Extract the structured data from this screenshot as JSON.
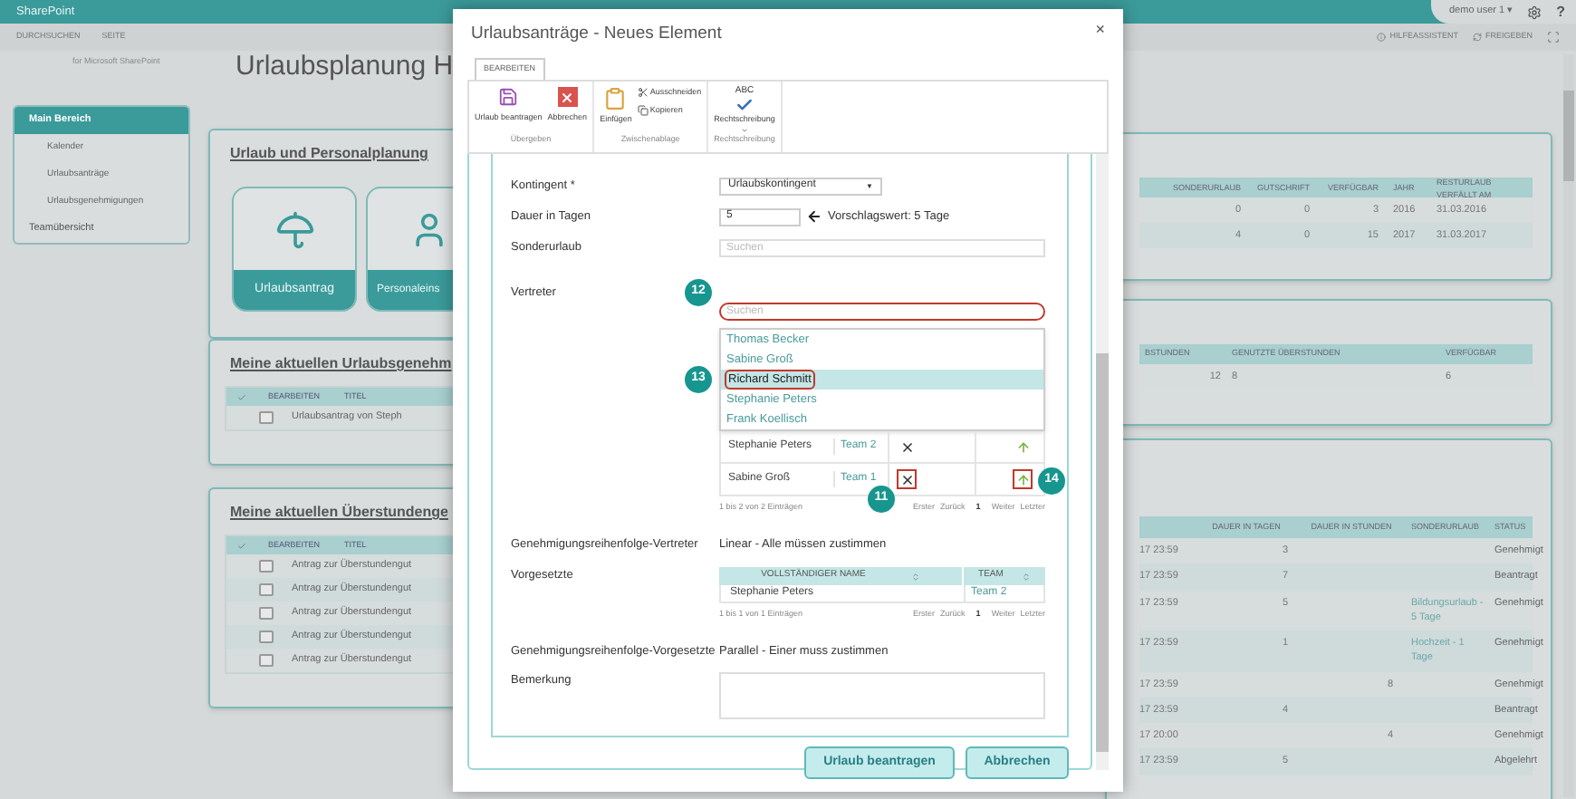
{
  "topbar": {
    "brand": "SharePoint",
    "user": "demo user 1 ▾",
    "help": "?"
  },
  "subbar": {
    "left": [
      "DURCHSUCHEN",
      "SEITE"
    ],
    "right": [
      {
        "label": "HILFEASSISTENT",
        "kind": "help"
      },
      {
        "label": "FREIGEBEN",
        "kind": "share"
      }
    ]
  },
  "logo_subtitle": "for Microsoft SharePoint",
  "page_title": "Urlaubsplanung H",
  "nav": [
    {
      "label": "Main Bereich",
      "selected": true,
      "children": [
        {
          "label": "Kalender"
        },
        {
          "label": "Urlaubsanträge"
        },
        {
          "label": "Urlaubsgenehmigungen"
        }
      ]
    },
    {
      "label": "Teamübersicht",
      "selected": false
    }
  ],
  "planning_panel": {
    "title": "Urlaub und Personalplanung",
    "tiles": [
      {
        "label": "Urlaubsantrag",
        "kind": "beach"
      },
      {
        "label": "Personaleins",
        "kind": "staff"
      }
    ]
  },
  "approvals_panel": {
    "title": "Meine aktuellen Urlaubsgenehm",
    "columns": [
      "BEARBEITEN",
      "TITEL"
    ],
    "rows": [
      "Urlaubsantrag von Steph"
    ]
  },
  "overtime_panel": {
    "title": "Meine aktuellen Überstundenge",
    "columns": [
      "BEARBEITEN",
      "TITEL"
    ],
    "rows": [
      "Antrag zur Überstundengut",
      "Antrag zur Überstundengut",
      "Antrag zur Überstundengut",
      "Antrag zur Überstundengut",
      "Antrag zur Überstundengut"
    ]
  },
  "quota_table": {
    "columns": [
      "SONDERURLAUB",
      "GUTSCHRIFT",
      "VERFÜGBAR",
      "JAHR",
      "RESTURLAUB VERFÄLLT AM"
    ],
    "rows": [
      [
        "0",
        "0",
        "3",
        "2016",
        "31.03.2016"
      ],
      [
        "4",
        "0",
        "15",
        "2017",
        "31.03.2017"
      ]
    ]
  },
  "overtime_table": {
    "columns": [
      "BSTUNDEN",
      "GENUTZTE ÜBERSTUNDEN",
      "VERFÜGBAR"
    ],
    "rows": [
      [
        "12",
        "8",
        "6"
      ]
    ]
  },
  "requests_table": {
    "columns": [
      "DAUER IN TAGEN",
      "DAUER IN STUNDEN",
      "SONDERURLAUB",
      "STATUS"
    ],
    "rows": [
      {
        "column_1": "17 23:59",
        "dauer_in_tagen": "3",
        "status": "Genehmigt"
      },
      {
        "column_1": "17 23:59",
        "dauer_in_tagen": "7",
        "status": "Beantragt"
      },
      {
        "column_1": "17 23:59",
        "dauer_in_tagen": "5",
        "sonderurlaub": "Bildungsurlaub - 5 Tage",
        "status": "Genehmigt"
      },
      {
        "column_1": "17 23:59",
        "dauer_in_tagen": "1",
        "sonderurlaub": "Hochzeit - 1 Tage",
        "status": "Genehmigt"
      },
      {
        "column_1": "17 23:59",
        "dauer_in_stunden": "8",
        "status": "Genehmigt"
      },
      {
        "column_1": "17 23:59",
        "dauer_in_tagen": "4",
        "status": "Beantragt"
      },
      {
        "column_1": "17 20:00",
        "dauer_in_stunden": "4",
        "status": "Genehmigt"
      },
      {
        "column_1": "17 23:59",
        "dauer_in_tagen": "5",
        "status": "Abgelehrt"
      }
    ]
  },
  "dialog": {
    "title": "Urlaubsanträge - Neues Element",
    "close": "×",
    "ribbon": {
      "tabs": [
        {
          "label": "BEARBEITEN",
          "selected": true
        }
      ],
      "groups": [
        {
          "label": "Übergeben",
          "buttons": [
            {
              "label": "Urlaub beantragen",
              "kind": "save"
            },
            {
              "label": "Abbrechen",
              "kind": "cancel"
            }
          ]
        },
        {
          "label": "Zwischenablage",
          "buttons": [
            {
              "label": "Einfügen",
              "kind": "paste"
            },
            {
              "label": "Ausschneiden",
              "kind": "cut"
            },
            {
              "label": "Kopieren",
              "kind": "copy"
            }
          ]
        },
        {
          "label": "Rechtschreibung",
          "buttons": [
            {
              "label": "Rechtschreibung",
              "kind": "spelling",
              "icon_text": "ABC"
            }
          ]
        }
      ]
    },
    "fields": [
      {
        "kind": "select",
        "label": "Kontingent *",
        "value": "Urlaubskontingent",
        "arrow": "▼"
      },
      {
        "kind": "number",
        "label": "Dauer in Tagen",
        "value": "5",
        "hint": "Vorschlagswert: 5 Tage"
      },
      {
        "kind": "search",
        "label": "Sonderurlaub",
        "placeholder": "Suchen"
      },
      {
        "kind": "people",
        "label": "Vertreter",
        "placeholder": "Suchen",
        "badge": "12",
        "suggestions": [
          {
            "label": "Thomas Becker",
            "selected": false
          },
          {
            "label": "Sabine Groß",
            "selected": false
          },
          {
            "label": "Richard Schmitt",
            "selected": true,
            "badge": "13"
          },
          {
            "label": "Stephanie Peters",
            "selected": false
          },
          {
            "label": "Frank Koellisch",
            "selected": false
          }
        ],
        "rows": [
          {
            "name": "Stephanie Peters",
            "team": "Team 2"
          },
          {
            "name": "Sabine Groß",
            "team": "Team 1",
            "remove_badge": "11",
            "move_badge": "14"
          }
        ],
        "summary": "1 bis 2 von 2 Einträgen",
        "pager": [
          "Erster",
          "Zurück",
          "1",
          "Weiter",
          "Letzter"
        ]
      },
      {
        "kind": "text",
        "label": "Genehmigungsreihenfolge-Vertreter",
        "value": "Linear - Alle müssen zustimmen"
      },
      {
        "kind": "table",
        "label": "Vorgesetzte",
        "columns": [
          "VOLLSTÄNDIGER NAME",
          "TEAM"
        ],
        "rows": [
          [
            "Stephanie Peters",
            "Team 2"
          ]
        ],
        "summary": "1 bis 1 von 1 Einträgen",
        "pager": [
          "Erster",
          "Zurück",
          "1",
          "Weiter",
          "Letzter"
        ]
      },
      {
        "kind": "text",
        "label": "Genehmigungsreihenfolge-Vorgesetzte",
        "value": "Parallel - Einer muss zustimmen"
      },
      {
        "kind": "textarea",
        "label": "Bemerkung"
      }
    ],
    "buttons": [
      "Urlaub beantragen",
      "Abbrechen"
    ]
  }
}
